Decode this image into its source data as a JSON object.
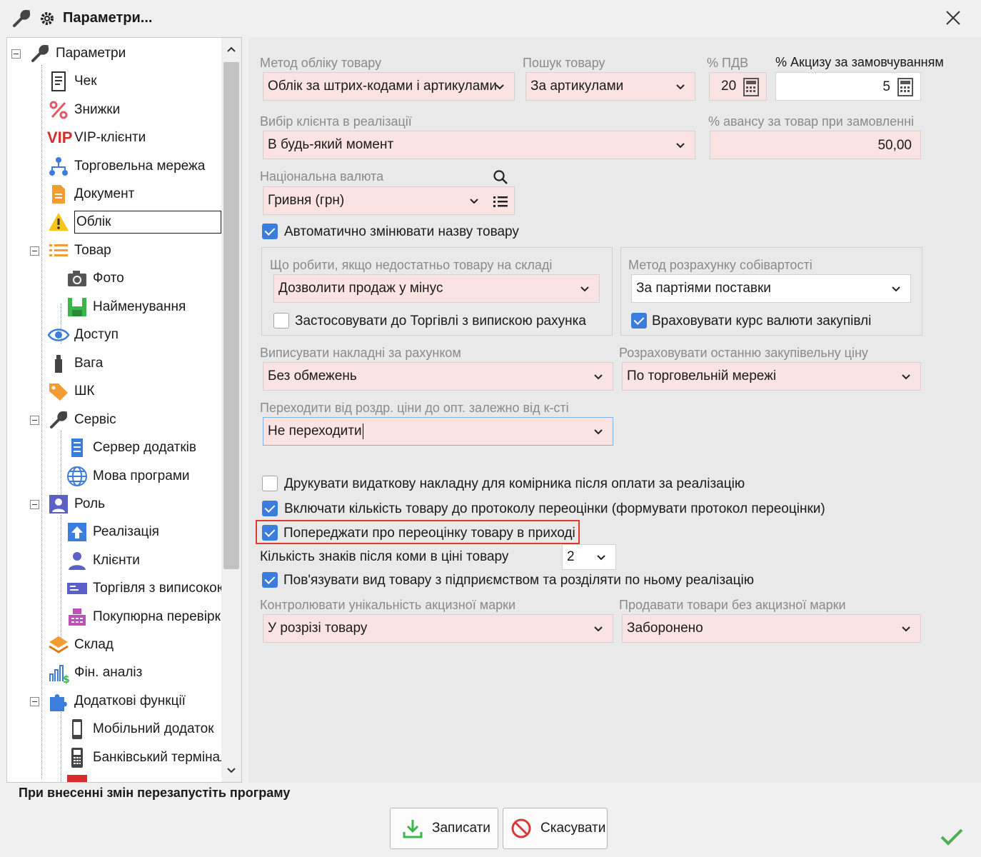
{
  "window": {
    "title": "Параметри..."
  },
  "tree": {
    "items": [
      {
        "label": "Параметри"
      },
      {
        "label": "Чек"
      },
      {
        "label": "Знижки"
      },
      {
        "label": "VIP-клієнти"
      },
      {
        "label": "Торговельна мережа"
      },
      {
        "label": "Документ"
      },
      {
        "label": "Облік"
      },
      {
        "label": "Товар"
      },
      {
        "label": "Фото"
      },
      {
        "label": "Найменування"
      },
      {
        "label": "Доступ"
      },
      {
        "label": "Вага"
      },
      {
        "label": "ШК"
      },
      {
        "label": "Сервіс"
      },
      {
        "label": "Сервер додатків"
      },
      {
        "label": "Мова програми"
      },
      {
        "label": "Роль"
      },
      {
        "label": "Реалізація"
      },
      {
        "label": "Клієнти"
      },
      {
        "label": "Торгівля з виписокою"
      },
      {
        "label": "Покупюрна перевірка"
      },
      {
        "label": "Склад"
      },
      {
        "label": "Фін. аналіз"
      },
      {
        "label": "Додаткові функції"
      },
      {
        "label": "Мобільний додаток"
      },
      {
        "label": "Банківський термінал"
      }
    ],
    "vip_text": "VIP"
  },
  "form": {
    "accounting_method": {
      "label": "Метод обліку товару",
      "value": "Облік за штрих-кодами і артикулами"
    },
    "product_search": {
      "label": "Пошук товару",
      "value": "За артикулами"
    },
    "vat": {
      "label": "% ПДВ",
      "value": "20"
    },
    "excise": {
      "label": "% Акцизу за замовчуванням",
      "value": "5"
    },
    "client_choice": {
      "label": "Вибір клієнта в реалізації",
      "value": "В будь-який момент"
    },
    "advance": {
      "label": "% авансу за товар при замовленні",
      "value": "50,00"
    },
    "currency": {
      "label": "Національна валюта",
      "value": "Гривня (грн)"
    },
    "auto_rename": {
      "label": "Автоматично змінювати назву товару",
      "checked": true
    },
    "insufficient": {
      "label": "Що робити, якщо недостатньо товару на складі",
      "value": "Дозволити продаж у мінус",
      "apply_label": "Застосовувати до Торгівлі з випискою рахунка",
      "apply_checked": false
    },
    "cost_method": {
      "label": "Метод розрахунку собівартості",
      "value": "За партіями поставки",
      "rate_label": "Враховувати курс валюти закупівлі",
      "rate_checked": true
    },
    "invoices": {
      "label": "Виписувати накладні за рахунком",
      "value": "Без обмежень"
    },
    "last_purchase": {
      "label": "Розраховувати останню закупівельну ціну",
      "value": "По торговельній мережі"
    },
    "price_switch": {
      "label": "Переходити від роздр. ціни до опт. залежно від к-сті",
      "value": "Не переходити"
    },
    "print_invoice": {
      "label": "Друкувати видаткову накладну для комірника після оплати за реалізацію",
      "checked": false
    },
    "include_qty": {
      "label": "Включати кількість товару до протоколу переоцінки (формувати протокол переоцінки)",
      "checked": true
    },
    "warn_reval": {
      "label": "Попереджати про переоцінку товару в приході",
      "checked": true
    },
    "decimals": {
      "label": "Кількість знаків після коми в ціні товару",
      "value": "2"
    },
    "link_type": {
      "label": "Пов'язувати вид товару з підприємством та розділяти по ньому реалізацію",
      "checked": true
    },
    "excise_control": {
      "label": "Контролювати унікальність акцизної марки",
      "value": "У розрізі товару"
    },
    "sell_no_excise": {
      "label": "Продавати товари без акцизної марки",
      "value": "Заборонено"
    }
  },
  "footer": {
    "note": "При внесенні змін перезапустіть програму",
    "save": "Записати",
    "cancel": "Скасувати"
  }
}
